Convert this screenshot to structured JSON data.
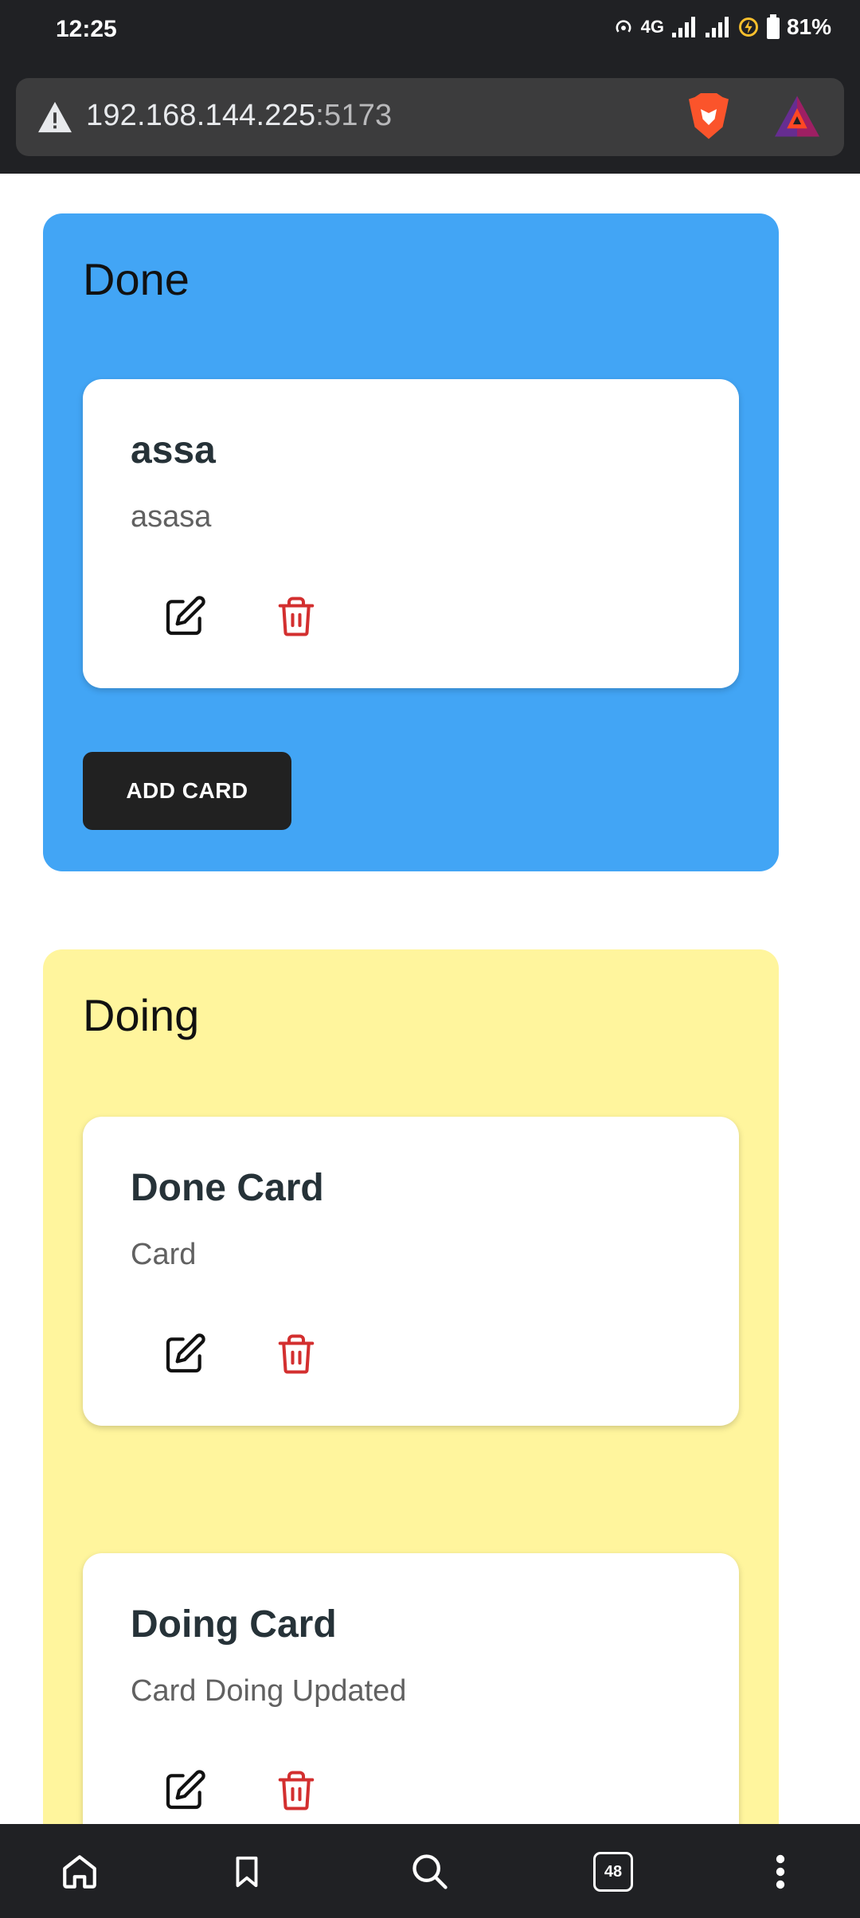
{
  "status_bar": {
    "time": "12:25",
    "battery": "81%",
    "network": "4G",
    "icons": [
      "hotspot-icon",
      "signal-icon",
      "signal-icon",
      "data-saver-icon",
      "battery-icon"
    ]
  },
  "browser": {
    "url_host": "192.168.144.225",
    "url_port": ":5173",
    "tab_count": "48"
  },
  "board": {
    "columns": [
      {
        "title": "Done",
        "color": "#42a5f5",
        "cards": [
          {
            "title": "assa",
            "description": "asasa"
          }
        ],
        "add_label": "ADD CARD"
      },
      {
        "title": "Doing",
        "color": "#fff59d",
        "cards": [
          {
            "title": "Done Card",
            "description": "Card"
          },
          {
            "title": "Doing Card",
            "description": "Card Doing Updated"
          }
        ]
      }
    ]
  },
  "colors": {
    "edit_icon": "#111111",
    "delete_icon": "#d32f2f",
    "chrome_bg": "#202124"
  }
}
